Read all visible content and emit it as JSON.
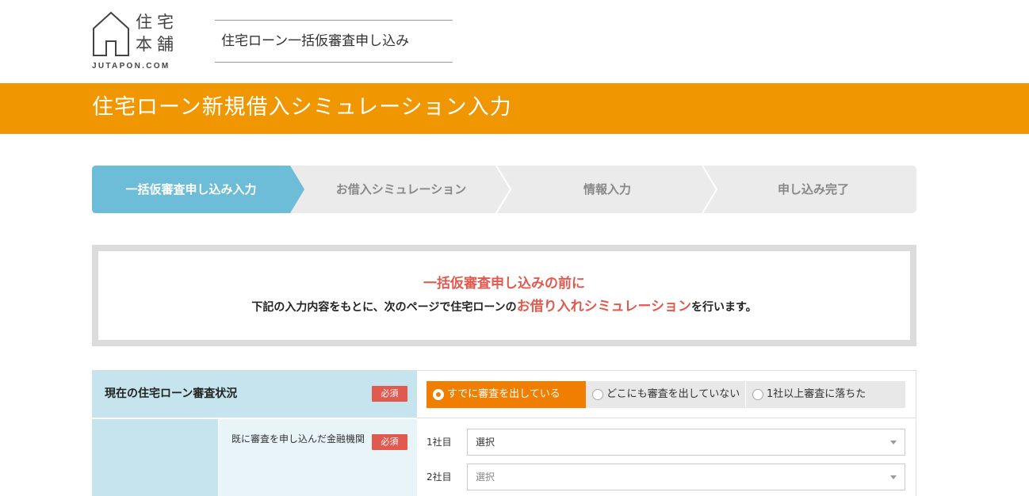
{
  "header": {
    "logo_kanji": "住宅本舗",
    "logo_sub": "JUTAPON.COM",
    "tag": "住宅ローン一括仮審査申し込み"
  },
  "title": "住宅ローン新規借入シミュレーション入力",
  "steps": [
    {
      "label": "一括仮審査申し込み入力",
      "active": true
    },
    {
      "label": "お借入シミュレーション",
      "active": false
    },
    {
      "label": "情報入力",
      "active": false
    },
    {
      "label": "申し込み完了",
      "active": false
    }
  ],
  "notice": {
    "heading": "一括仮審査申し込みの前に",
    "body_before": "下記の入力内容をもとに、次のページで住宅ローンの",
    "body_highlight": "お借り入れシミュレーション",
    "body_after": "を行います。"
  },
  "form": {
    "status_label": "現在の住宅ローン審査状況",
    "required": "必須",
    "radio_options": [
      {
        "label": "すでに審査を出している",
        "selected": true
      },
      {
        "label": "どこにも審査を出していない",
        "selected": false
      },
      {
        "label": "1社以上審査に落ちた",
        "selected": false
      }
    ],
    "institutions_label": "既に審査を申し込んだ金融機関",
    "selects": [
      {
        "num": "1社目",
        "value": "選択"
      },
      {
        "num": "2社目",
        "value": "選択"
      }
    ]
  },
  "colors": {
    "brand_orange": "#f09600",
    "step_active": "#6dbcd8",
    "accent_red": "#e05a4f",
    "label_bg": "#c5e4ee"
  }
}
